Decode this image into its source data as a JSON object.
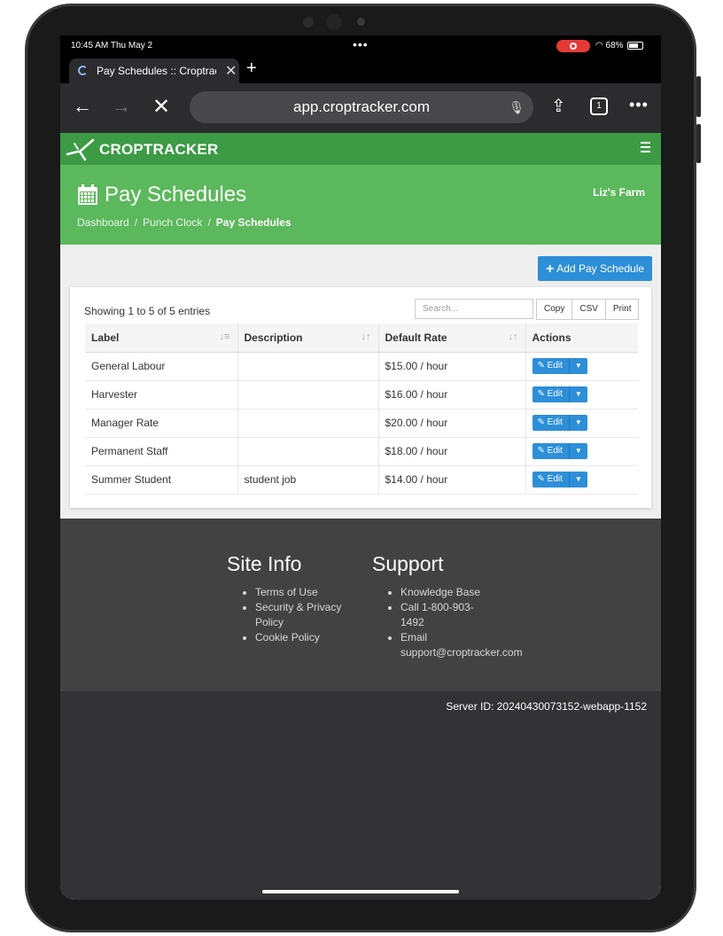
{
  "status_bar": {
    "time": "10:45 AM  Thu May 2",
    "battery": "68%"
  },
  "tab": {
    "title": "Pay Schedules :: Croptracker",
    "close": "✕",
    "new_tab": "+"
  },
  "toolbar": {
    "url": "app.croptracker.com",
    "tab_count": "1"
  },
  "app": {
    "brand": "CROPTRACKER",
    "page_title": "Pay Schedules",
    "farm_name": "Liz's Farm",
    "breadcrumb": [
      "Dashboard",
      "Punch Clock",
      "Pay Schedules"
    ],
    "add_button": "Add Pay Schedule"
  },
  "table": {
    "showing": "Showing 1 to 5 of 5 entries",
    "search_placeholder": "Search...",
    "export_buttons": [
      "Copy",
      "CSV",
      "Print"
    ],
    "columns": [
      "Label",
      "Description",
      "Default Rate",
      "Actions"
    ],
    "rows": [
      {
        "label": "General Labour",
        "description": "",
        "rate": "$15.00 / hour",
        "action": "Edit"
      },
      {
        "label": "Harvester",
        "description": "",
        "rate": "$16.00 / hour",
        "action": "Edit"
      },
      {
        "label": "Manager Rate",
        "description": "",
        "rate": "$20.00 / hour",
        "action": "Edit"
      },
      {
        "label": "Permanent Staff",
        "description": "",
        "rate": "$18.00 / hour",
        "action": "Edit"
      },
      {
        "label": "Summer Student",
        "description": "student job",
        "rate": "$14.00 / hour",
        "action": "Edit"
      }
    ]
  },
  "footer": {
    "site_info": {
      "title": "Site Info",
      "links": [
        "Terms of Use",
        "Security & Privacy Policy",
        "Cookie Policy"
      ]
    },
    "support": {
      "title": "Support",
      "links": [
        "Knowledge Base",
        "Call 1-800-903-1492",
        "Email support@croptracker.com"
      ]
    },
    "server_id": "Server ID: 20240430073152-webapp-1152"
  },
  "colors": {
    "nav_green": "#3c9b44",
    "header_green": "#5cb85c",
    "primary_blue": "#2d8fd8",
    "footer_gray": "#424242"
  }
}
